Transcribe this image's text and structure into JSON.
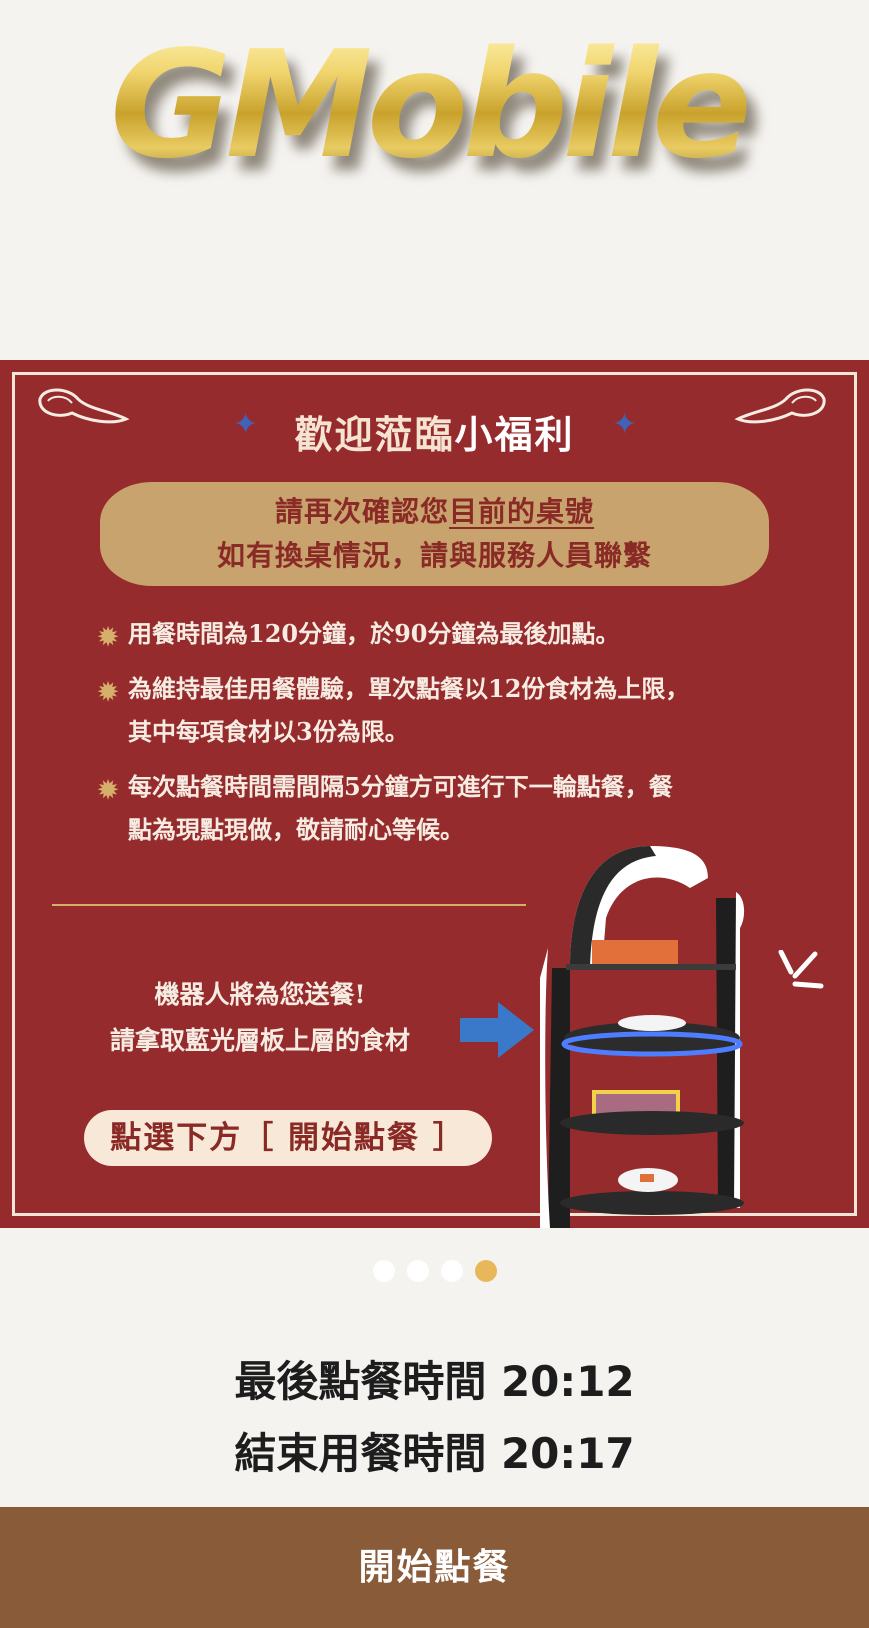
{
  "logo": {
    "text": "GMobile"
  },
  "banner": {
    "title_prefix": "歡迎蒞臨",
    "title_highlight": "小福利",
    "confirm_line1_prefix": "請再次確認您",
    "confirm_line1_underlined": "目前的桌號",
    "confirm_line2": "如有換桌情況，請與服務人員聯繫",
    "rules": [
      {
        "lines": [
          "用餐時間為120分鐘，於90分鐘為最後加點。"
        ]
      },
      {
        "lines": [
          "為維持最佳用餐體驗，單次點餐以12份食材為上限，",
          "其中每項食材以3份為限。"
        ]
      },
      {
        "lines": [
          "每次點餐時間需間隔5分鐘方可進行下一輪點餐，餐",
          "點為現點現做，敬請耐心等候。"
        ]
      }
    ],
    "robot_line1": "機器人將為您送餐!",
    "robot_line2": "請拿取藍光層板上層的食材",
    "start_hint": "點選下方［ 開始點餐 ］",
    "colors": {
      "background": "#962b2d",
      "gold": "#c9a36d",
      "cream": "#f6ece2"
    }
  },
  "carousel": {
    "total": 4,
    "active_index": 3,
    "active_color": "#e7b75a"
  },
  "times": {
    "last_order": "最後點餐時間 20:12",
    "end_dining": "結束用餐時間 20:17"
  },
  "bottom_button": {
    "label": "開始點餐",
    "color": "#8a5b38"
  }
}
